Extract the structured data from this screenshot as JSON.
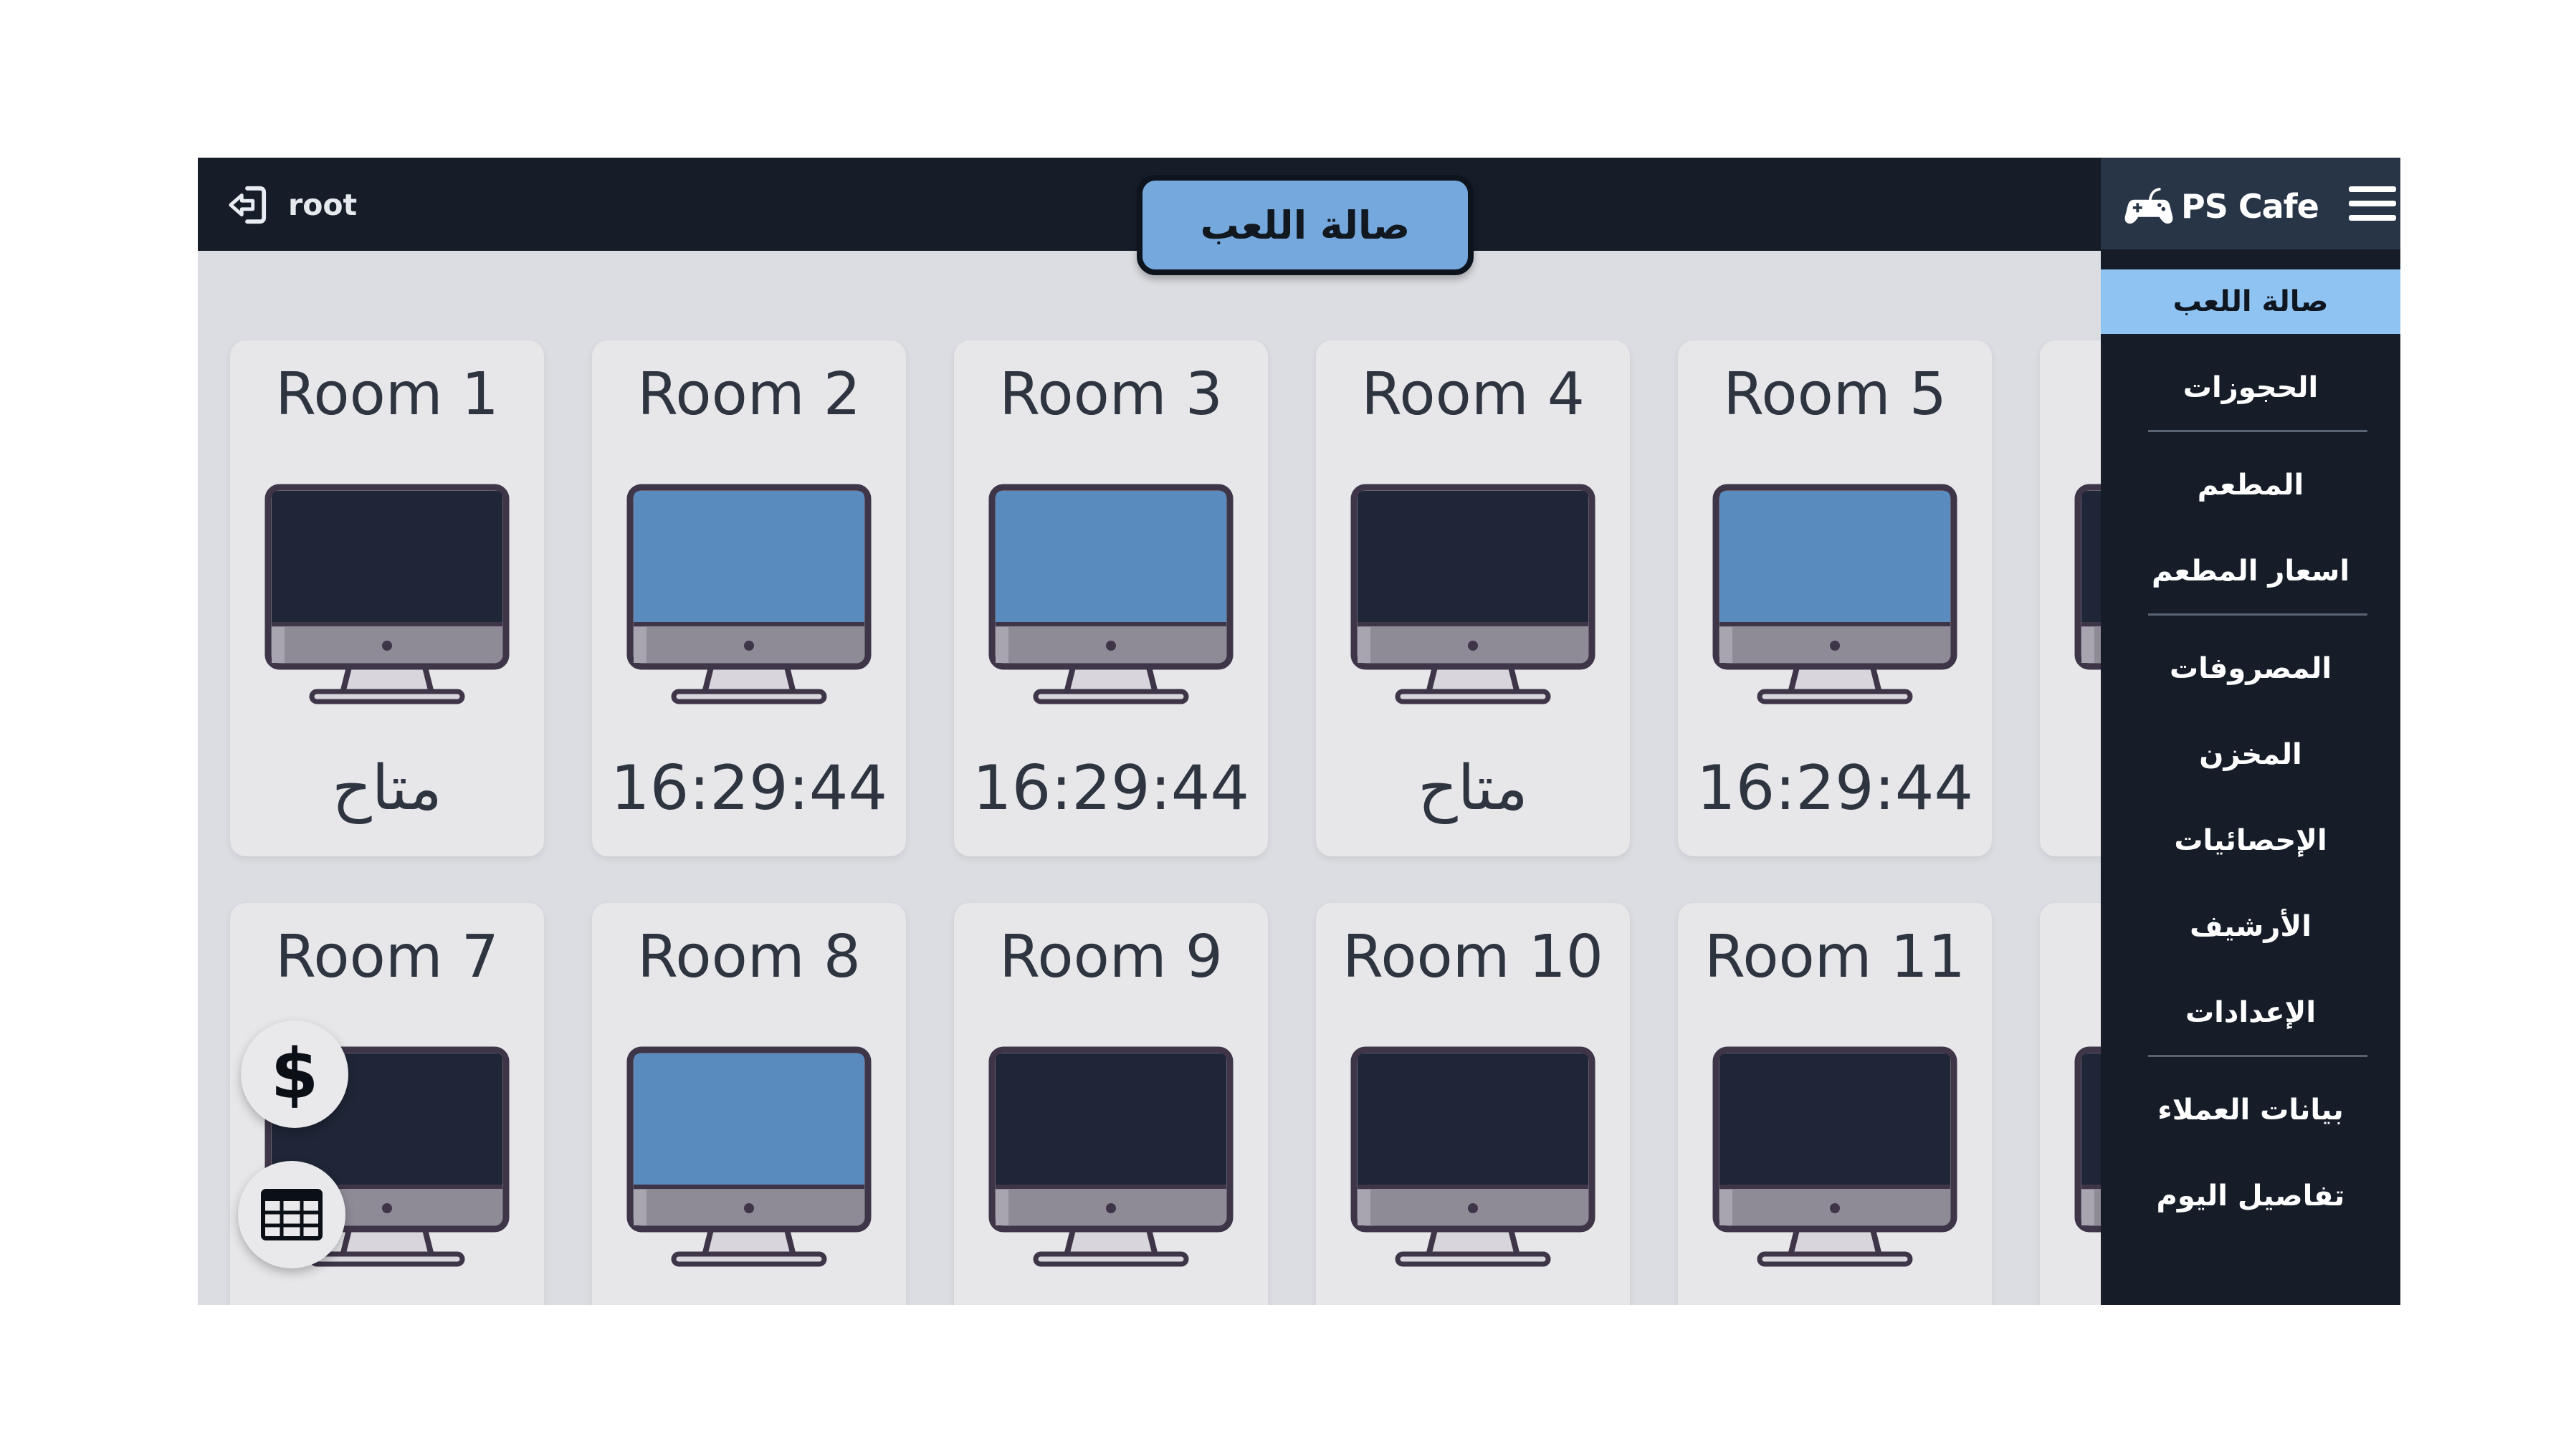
{
  "header": {
    "user": "root",
    "page_title": "صالة اللعب"
  },
  "brand": {
    "name": "PS Cafe"
  },
  "nav": {
    "items": [
      {
        "label": "صالة اللعب",
        "active": true
      },
      {
        "label": "الحجوزات",
        "active": false
      },
      {
        "label": "المطعم",
        "active": false
      },
      {
        "label": "اسعار المطعم",
        "active": false
      },
      {
        "label": "المصروفات",
        "active": false
      },
      {
        "label": "المخزن",
        "active": false
      },
      {
        "label": "الإحصائيات",
        "active": false
      },
      {
        "label": "الأرشيف",
        "active": false
      },
      {
        "label": "الإعدادات",
        "active": false
      },
      {
        "label": "بيانات العملاء",
        "active": false
      },
      {
        "label": "تفاصيل اليوم",
        "active": false
      }
    ]
  },
  "rooms": [
    {
      "name": "Room 1",
      "status": "متاح",
      "occupied": false
    },
    {
      "name": "Room 2",
      "status": "16:29:44",
      "occupied": true
    },
    {
      "name": "Room 3",
      "status": "16:29:44",
      "occupied": true
    },
    {
      "name": "Room 4",
      "status": "متاح",
      "occupied": false
    },
    {
      "name": "Room 5",
      "status": "16:29:44",
      "occupied": true
    },
    {
      "name": "R",
      "status": "",
      "occupied": false
    },
    {
      "name": "Room 7",
      "status": "",
      "occupied": false
    },
    {
      "name": "Room 8",
      "status": "",
      "occupied": true
    },
    {
      "name": "Room 9",
      "status": "",
      "occupied": false
    },
    {
      "name": "Room 10",
      "status": "",
      "occupied": false
    },
    {
      "name": "Room 11",
      "status": "",
      "occupied": false
    },
    {
      "name": "R",
      "status": "",
      "occupied": false
    }
  ],
  "fabs": {
    "dollar": "$"
  },
  "colors": {
    "screen_occupied": "#5a8bbf",
    "screen_free": "#1f2637",
    "active_nav": "#8fc4f2",
    "title_pill": "#75a8dc",
    "topbar": "#161d29"
  }
}
